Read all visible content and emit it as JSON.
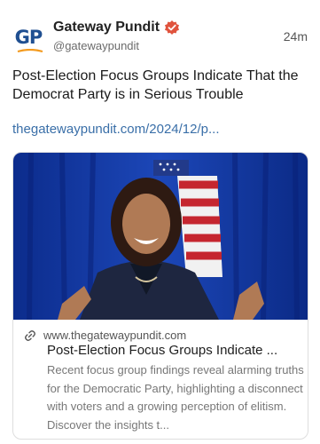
{
  "post": {
    "author": "Gateway Pundit",
    "handle": "@gatewaypundit",
    "time": "24m",
    "logo_text": "GP",
    "text": "Post-Election Focus Groups Indicate That the Democrat Party is in Serious Trouble",
    "link": "thegatewaypundit.com/2024/12/p..."
  },
  "card": {
    "domain": "www.thegatewaypundit.com",
    "title": "Post-Election Focus Groups Indicate ...",
    "description": "Recent focus group findings reveal alarming truths for the Democratic Party, highlighting a disconnect with voters and a growing perception of elitism. Discover the insights t..."
  },
  "colors": {
    "verified": "#e0533d",
    "link": "#3a6fa8",
    "logo_blue": "#1f4f91",
    "logo_orange": "#f39a1e"
  },
  "icons": {
    "verified": "verified-badge-icon",
    "link": "link-icon"
  }
}
